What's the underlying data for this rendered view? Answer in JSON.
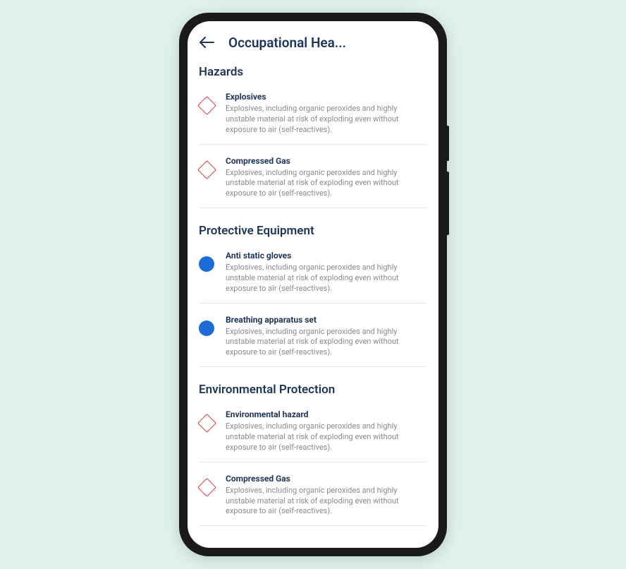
{
  "header": {
    "title": "Occupational Hea..."
  },
  "sections": [
    {
      "title": "Hazards",
      "items": [
        {
          "icon": "diamond",
          "title": "Explosives",
          "desc": "Explosives, including organic peroxides and highly unstable material at risk of exploding even without exposure to air (self-reactives)."
        },
        {
          "icon": "diamond",
          "title": "Compressed Gas",
          "desc": "Explosives, including organic peroxides and highly unstable material at risk of exploding even without exposure to air (self-reactives)."
        }
      ]
    },
    {
      "title": "Protective Equipment",
      "items": [
        {
          "icon": "circle",
          "title": "Anti static gloves",
          "desc": "Explosives, including organic peroxides and highly unstable material at risk of exploding even without exposure to air (self-reactives)."
        },
        {
          "icon": "circle",
          "title": "Breathing apparatus set",
          "desc": "Explosives, including organic peroxides and highly unstable material at risk of exploding even without exposure to air (self-reactives)."
        }
      ]
    },
    {
      "title": "Environmental Protection",
      "items": [
        {
          "icon": "diamond",
          "title": "Environmental hazard",
          "desc": "Explosives, including organic peroxides and highly unstable material at risk of exploding even without exposure to air (self-reactives)."
        },
        {
          "icon": "diamond",
          "title": "Compressed Gas",
          "desc": "Explosives, including organic peroxides and highly unstable material at risk of exploding even without exposure to air (self-reactives)."
        }
      ]
    }
  ]
}
